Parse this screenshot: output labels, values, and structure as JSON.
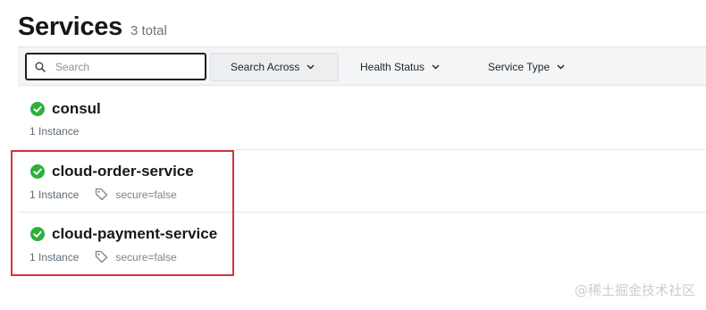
{
  "header": {
    "title": "Services",
    "count": "3 total"
  },
  "filters": {
    "search_placeholder": "Search",
    "search_value": "",
    "search_across": "Search Across",
    "health_status": "Health Status",
    "service_type": "Service Type"
  },
  "services": [
    {
      "name": "consul",
      "instances": "1 Instance",
      "tag": "",
      "status": "passing"
    },
    {
      "name": "cloud-order-service",
      "instances": "1 Instance",
      "tag": "secure=false",
      "status": "passing"
    },
    {
      "name": "cloud-payment-service",
      "instances": "1 Instance",
      "tag": "secure=false",
      "status": "passing"
    }
  ],
  "colors": {
    "passing": "#2eb039",
    "highlight": "#d2343b"
  },
  "watermark": "@稀土掘金技术社区"
}
